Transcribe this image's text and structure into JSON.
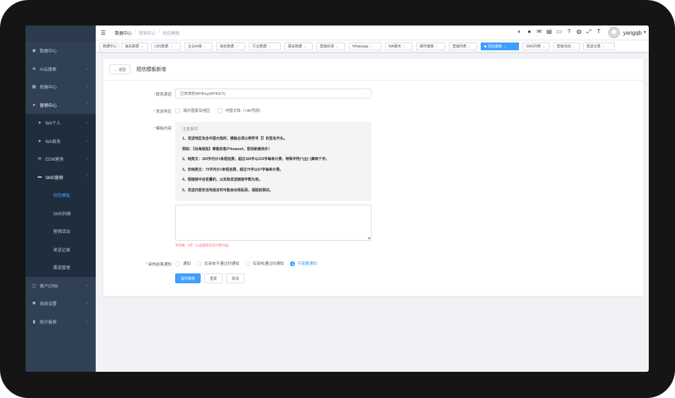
{
  "breadcrumb": [
    "数据中心",
    "营销中心",
    "短信模板"
  ],
  "user": {
    "name": "yangqb"
  },
  "sidebar": {
    "items": [
      {
        "label": "数据中心",
        "icon": "database-icon",
        "glyph": "◉"
      },
      {
        "label": "AI云搜索",
        "icon": "gear-icon",
        "glyph": "✲"
      },
      {
        "label": "拓展中心",
        "icon": "grid-icon",
        "glyph": "▦"
      },
      {
        "label": "营销中心",
        "icon": "send-icon",
        "glyph": "➤"
      }
    ],
    "marketing_children": [
      {
        "label": "WA个人",
        "icon": "send-icon",
        "glyph": "➤"
      },
      {
        "label": "WA商务",
        "icon": "send-icon",
        "glyph": "➤"
      },
      {
        "label": "EDM营销",
        "icon": "mail-icon",
        "glyph": "✉"
      },
      {
        "label": "SMS营销",
        "icon": "message-icon",
        "glyph": "▬"
      }
    ],
    "sms_children": [
      "短信模板",
      "SMS列表",
      "营销活动",
      "发送记录",
      "渠道管理"
    ],
    "bottom_items": [
      {
        "label": "客户CRM",
        "icon": "crm-icon",
        "glyph": "▢"
      },
      {
        "label": "系统设置",
        "icon": "settings-icon",
        "glyph": "✺"
      },
      {
        "label": "统计报表",
        "icon": "bar-chart-icon",
        "glyph": "▮"
      }
    ]
  },
  "tags": [
    "数据中心",
    "海关数据",
    "LBS数据",
    "企业AI搜",
    "域名数据",
    "行业数据",
    "展会数据",
    "营销反馈",
    "Whatsapp",
    "WA聊天",
    "邮件模板",
    "营销列表",
    "短信模板",
    "SMS列表",
    "营销活动",
    "发送记录"
  ],
  "active_tag_index": 12,
  "page": {
    "back": "← 返回",
    "title": "短信模板新增"
  },
  "form": {
    "channel_label": "联系渠道",
    "channel_value": "已失效的APIKey(APIKEY)",
    "region_label": "发送地区",
    "region_options": [
      "海外国家及地区",
      "中国大陆（+86号段）"
    ],
    "content_label": "模板内容",
    "notice_title": "注意事项",
    "notice_lines": [
      "1、发送地区包含中国大陆时，模板必须以带符号【】的签名开头。",
      "例如：【出海易拓】尊敬的客户#name#，祝你新春快乐！",
      "2、纯英文：160字内计1条短信费，超过160字以153字每条计费，特殊字符(^{}[]~)算两个字。",
      "3、非纯英文：70字内计1条短信费，超过70字以67字每条计费。",
      "4、短链接中含变量的，以实际发送链接字数为准。",
      "5、发送内容非当地语言时可能会出现乱码，请提前测试。"
    ],
    "char_count": "字符数：0字（以运营商实际计费为准）",
    "notify_label": "审核结果通知",
    "notify_options": [
      "通知",
      "仅审核不通过时通知",
      "仅审核通过时通知",
      "不需要通知"
    ],
    "notify_selected": 3,
    "buttons": {
      "submit": "提交审核",
      "reset": "重置",
      "cancel": "取消"
    }
  },
  "colors": {
    "sidebar": "#304156",
    "accent": "#409eff",
    "required": "#f56c6c"
  }
}
